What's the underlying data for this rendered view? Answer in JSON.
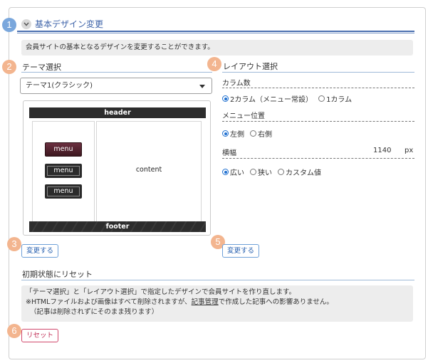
{
  "section": {
    "title": "基本デザイン変更",
    "description": "会員サイトの基本となるデザインを変更することができます。"
  },
  "badges": [
    "1",
    "2",
    "3",
    "4",
    "5",
    "6"
  ],
  "theme": {
    "heading": "テーマ選択",
    "select_value": "テーマ1(クラシック)",
    "preview": {
      "header": "header",
      "footer": "footer",
      "content": "content",
      "menu_items": [
        "menu",
        "menu",
        "menu"
      ]
    },
    "change_button": "変更する"
  },
  "layout": {
    "heading": "レイアウト選択",
    "columns": {
      "label": "カラム数",
      "options": [
        "2カラム（メニュー常設）",
        "1カラム"
      ],
      "selected": 0
    },
    "menu_position": {
      "label": "メニュー位置",
      "options": [
        "左側",
        "右側"
      ],
      "selected": 0
    },
    "width": {
      "label": "横幅",
      "value": "1140",
      "unit": "px",
      "options": [
        "広い",
        "狭い",
        "カスタム値"
      ],
      "selected": 0
    },
    "change_button": "変更する"
  },
  "reset": {
    "heading": "初期状態にリセット",
    "note_line1": "「テーマ選択」と「レイアウト選択」で指定したデザインで会員サイトを作り直します。",
    "note_line2_pre": "※HTMLファイルおよび画像はすべて削除されますが、",
    "note_line2_link": "記事管理",
    "note_line2_post": "で作成した記事への影響ありません。",
    "note_line3": "（記事は削除されずにそのまま残ります）",
    "button": "リセット"
  },
  "colors": {
    "accent_blue": "#3c62a8",
    "badge_orange": "#f3b58f",
    "badge_blue": "#7aa7dc",
    "radio_selected": "#1e6fd0",
    "reset_red": "#c02d55"
  }
}
